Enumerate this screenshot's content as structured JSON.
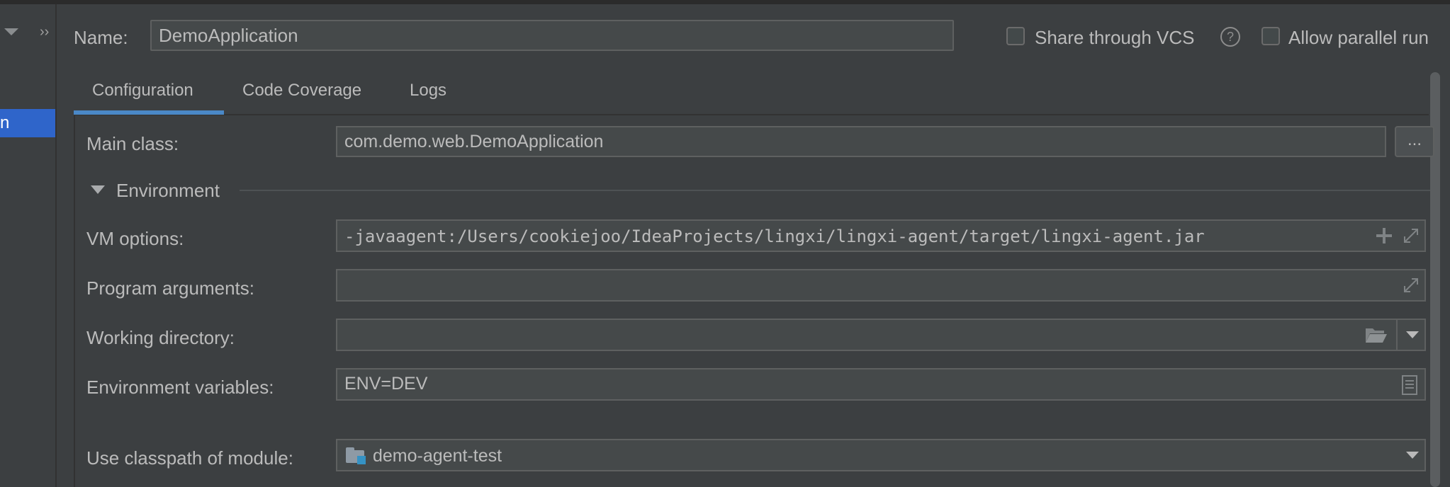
{
  "left_panel": {
    "selected_item_fragment": "n",
    "more_glyph": "››"
  },
  "header": {
    "name_label": "Name:",
    "name_value": "DemoApplication",
    "share_vcs_label": "Share through VCS",
    "help_glyph": "?",
    "allow_parallel_label": "Allow parallel run"
  },
  "tabs": [
    {
      "label": "Configuration",
      "active": true
    },
    {
      "label": "Code Coverage",
      "active": false
    },
    {
      "label": "Logs",
      "active": false
    }
  ],
  "form": {
    "main_class_label": "Main class:",
    "main_class_value": "com.demo.web.DemoApplication",
    "browse_label": "...",
    "environment_section": "Environment",
    "vm_options_label": "VM options:",
    "vm_options_value": "-javaagent:/Users/cookiejoo/IdeaProjects/lingxi/lingxi-agent/target/lingxi-agent.jar",
    "program_args_label": "Program arguments:",
    "program_args_value": "",
    "working_dir_label": "Working directory:",
    "working_dir_value": "",
    "env_vars_label": "Environment variables:",
    "env_vars_value": "ENV=DEV",
    "classpath_label": "Use classpath of module:",
    "classpath_value": "demo-agent-test"
  },
  "icons": {
    "expand": "expand-icon",
    "plus": "plus-icon",
    "folder": "folder-open-icon",
    "document": "document-icon",
    "help": "help-icon",
    "module": "module-folder-icon"
  },
  "colors": {
    "background": "#3c3f41",
    "input_bg": "#45494a",
    "selection": "#2f65ca",
    "tab_underline": "#4a88c7",
    "text": "#bbbbbb"
  }
}
